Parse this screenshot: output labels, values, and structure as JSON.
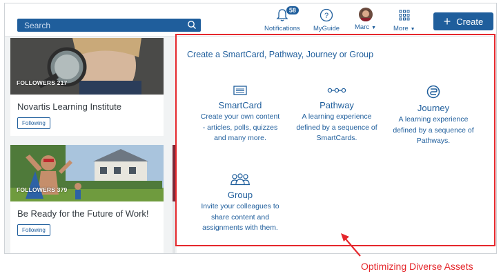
{
  "header": {
    "search": {
      "placeholder": "Search"
    },
    "notifications": {
      "label": "Notifications",
      "count": "58"
    },
    "myguide": {
      "label": "MyGuide"
    },
    "user": {
      "label": "Marc"
    },
    "more": {
      "label": "More"
    },
    "create": {
      "label": "Create"
    }
  },
  "cards": [
    {
      "followers": "FOLLOWERS 217",
      "title": "Novartis Learning Institute",
      "follow_label": "Following"
    },
    {
      "followers": "FOLLOWERS 379",
      "title": "Be Ready for the Future of Work!",
      "follow_label": "Following"
    }
  ],
  "panel": {
    "title": "Create a SmartCard, Pathway, Journey or Group",
    "options": [
      {
        "name": "SmartCard",
        "description": [
          "Create your own content",
          "- articles, polls, quizzes",
          "and many more."
        ],
        "icon": "smartcard-icon"
      },
      {
        "name": "Pathway",
        "description": [
          "A learning experience",
          "defined by a sequence of",
          "SmartCards."
        ],
        "icon": "pathway-icon"
      },
      {
        "name": "Journey",
        "description": [
          "A learning experience",
          "defined by a sequence of",
          "Pathways."
        ],
        "icon": "journey-icon"
      },
      {
        "name": "Group",
        "description": [
          "Invite your colleagues to",
          "share content and",
          "assignments with them."
        ],
        "icon": "group-icon"
      }
    ]
  },
  "annotation": {
    "caption": "Optimizing Diverse Assets",
    "color": "#e5272c"
  },
  "colors": {
    "brand": "#1f5e9c"
  }
}
